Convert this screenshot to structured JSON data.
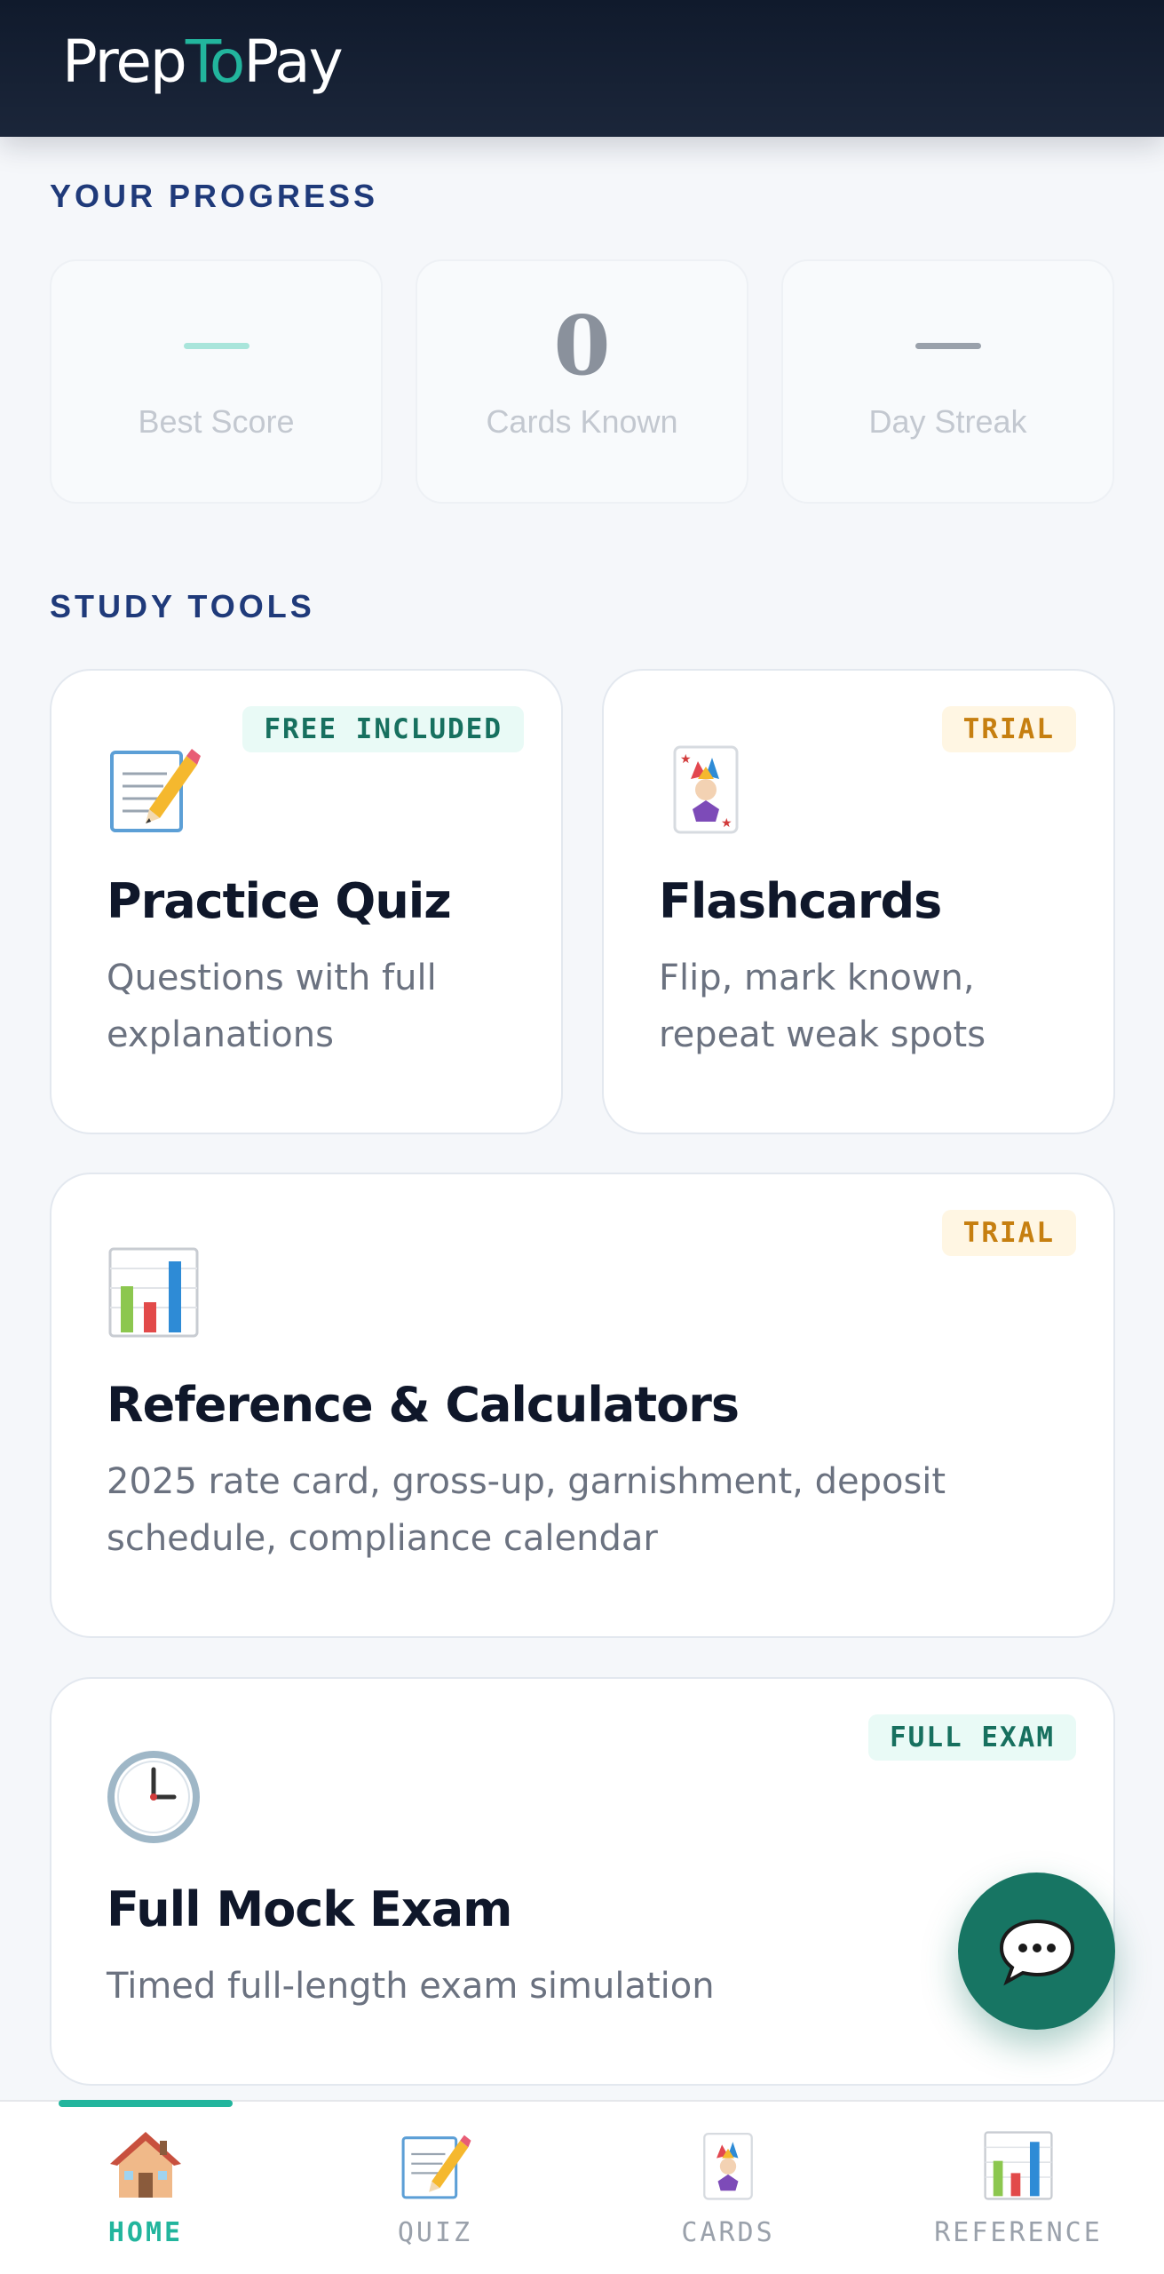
{
  "header": {
    "logo_part1": "Prep",
    "logo_part2": "To",
    "logo_part3": "Pay"
  },
  "progress": {
    "title": "YOUR PROGRESS",
    "stats": [
      {
        "value": "",
        "label": "Best Score",
        "accent": "#a9e5db"
      },
      {
        "value": "0",
        "label": "Cards Known"
      },
      {
        "value": "",
        "label": "Day Streak",
        "accent": "#9aa1ab"
      }
    ]
  },
  "tools": {
    "title": "STUDY TOOLS",
    "items": [
      {
        "badge": "FREE INCLUDED",
        "icon": "memo-pencil-icon",
        "title": "Practice Quiz",
        "desc": "Questions with full explanations"
      },
      {
        "badge": "TRIAL",
        "icon": "joker-card-icon",
        "title": "Flashcards",
        "desc": "Flip, mark known, repeat weak spots"
      },
      {
        "badge": "TRIAL",
        "icon": "bar-chart-icon",
        "title": "Reference & Calculators",
        "desc": "2025 rate card, gross-up, garnishment, deposit schedule, compliance calendar"
      },
      {
        "badge": "FULL EXAM",
        "icon": "clock-icon",
        "title": "Full Mock Exam",
        "desc": "Timed full-length exam simulation"
      }
    ]
  },
  "chat_fab": {
    "icon": "chat-bubble-icon"
  },
  "nav": {
    "items": [
      {
        "label": "HOME",
        "icon": "house-icon",
        "active": true
      },
      {
        "label": "QUIZ",
        "icon": "memo-pencil-icon"
      },
      {
        "label": "CARDS",
        "icon": "joker-card-icon"
      },
      {
        "label": "REFERENCE",
        "icon": "bar-chart-icon"
      }
    ]
  },
  "colors": {
    "header_bg": "#101a2c",
    "brand_teal": "#22b59d",
    "fab": "#177563",
    "section_title": "#1f3a7a",
    "badge_green_text": "#17705f",
    "badge_amber_text": "#c67f10"
  }
}
